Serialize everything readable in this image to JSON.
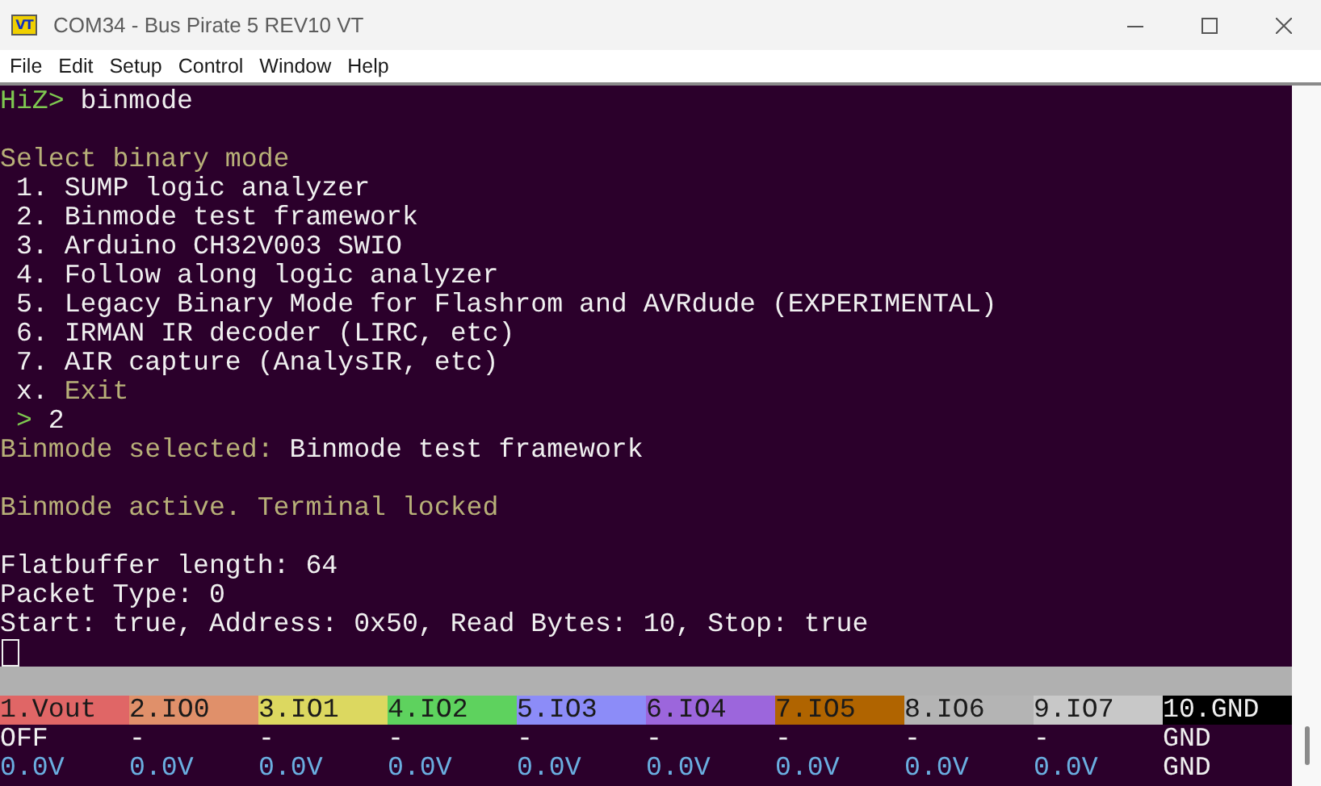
{
  "window": {
    "app_icon": "VT",
    "title": "COM34 - Bus Pirate 5 REV10 VT"
  },
  "menu": [
    "File",
    "Edit",
    "Setup",
    "Control",
    "Window",
    "Help"
  ],
  "terminal": {
    "lines": [
      {
        "kind": "text",
        "segments": [
          {
            "kind": "prompt",
            "text": "HiZ>"
          },
          {
            "kind": "plain",
            "text": " binmode"
          }
        ]
      },
      {
        "kind": "blank"
      },
      {
        "kind": "text",
        "segments": [
          {
            "kind": "accent",
            "text": "Select binary mode"
          }
        ]
      },
      {
        "kind": "text",
        "segments": [
          {
            "kind": "plain",
            "text": " 1. SUMP logic analyzer"
          }
        ]
      },
      {
        "kind": "text",
        "segments": [
          {
            "kind": "plain",
            "text": " 2. Binmode test framework"
          }
        ]
      },
      {
        "kind": "text",
        "segments": [
          {
            "kind": "plain",
            "text": " 3. Arduino CH32V003 SWIO"
          }
        ]
      },
      {
        "kind": "text",
        "segments": [
          {
            "kind": "plain",
            "text": " 4. Follow along logic analyzer"
          }
        ]
      },
      {
        "kind": "text",
        "segments": [
          {
            "kind": "plain",
            "text": " 5. Legacy Binary Mode for Flashrom and AVRdude (EXPERIMENTAL)"
          }
        ]
      },
      {
        "kind": "text",
        "segments": [
          {
            "kind": "plain",
            "text": " 6. IRMAN IR decoder (LIRC, etc)"
          }
        ]
      },
      {
        "kind": "text",
        "segments": [
          {
            "kind": "plain",
            "text": " 7. AIR capture (AnalysIR, etc)"
          }
        ]
      },
      {
        "kind": "text",
        "segments": [
          {
            "kind": "plain",
            "text": " x."
          },
          {
            "kind": "accent",
            "text": " Exit"
          }
        ]
      },
      {
        "kind": "text",
        "segments": [
          {
            "kind": "prompt",
            "text": " >"
          },
          {
            "kind": "plain",
            "text": " 2"
          }
        ]
      },
      {
        "kind": "text",
        "segments": [
          {
            "kind": "accent",
            "text": "Binmode selected:"
          },
          {
            "kind": "plain",
            "text": " Binmode test framework"
          }
        ]
      },
      {
        "kind": "blank"
      },
      {
        "kind": "text",
        "segments": [
          {
            "kind": "accent",
            "text": "Binmode active. Terminal locked"
          }
        ]
      },
      {
        "kind": "blank"
      },
      {
        "kind": "text",
        "segments": [
          {
            "kind": "plain",
            "text": "Flatbuffer length: 64"
          }
        ]
      },
      {
        "kind": "text",
        "segments": [
          {
            "kind": "plain",
            "text": "Packet Type: 0"
          }
        ]
      },
      {
        "kind": "text",
        "segments": [
          {
            "kind": "plain",
            "text": "Start: true, Address: 0x50, Read Bytes: 10, Stop: true"
          }
        ]
      },
      {
        "kind": "cursor"
      }
    ]
  },
  "pins": [
    {
      "label": "1.Vout",
      "color": "#e06666",
      "state": "OFF",
      "voltage": "0.0V"
    },
    {
      "label": "2.IO0",
      "color": "#e0906a",
      "state": "-",
      "voltage": "0.0V"
    },
    {
      "label": "3.IO1",
      "color": "#dcd860",
      "state": "-",
      "voltage": "0.0V"
    },
    {
      "label": "4.IO2",
      "color": "#5ed25e",
      "state": "-",
      "voltage": "0.0V"
    },
    {
      "label": "5.IO3",
      "color": "#8c8cf8",
      "state": "-",
      "voltage": "0.0V"
    },
    {
      "label": "6.IO4",
      "color": "#9c66dc",
      "state": "-",
      "voltage": "0.0V"
    },
    {
      "label": "7.IO5",
      "color": "#b06400",
      "state": "-",
      "voltage": "0.0V"
    },
    {
      "label": "8.IO6",
      "color": "#b4b4b4",
      "state": "-",
      "voltage": "0.0V"
    },
    {
      "label": "9.IO7",
      "color": "#c8c8c8",
      "state": "-",
      "voltage": "0.0V"
    },
    {
      "label": "10.GND",
      "color": "#000000",
      "state": "GND",
      "voltage": "GND"
    }
  ]
}
